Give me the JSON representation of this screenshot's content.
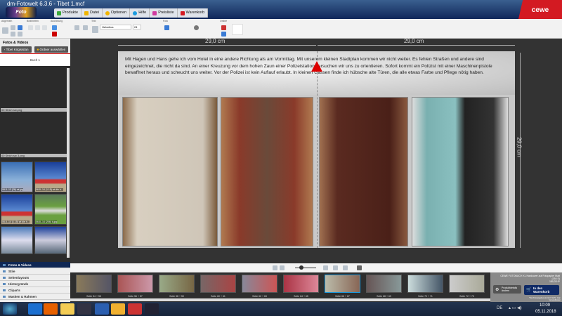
{
  "window": {
    "title": "dm-Fotowelt 6.3.6 - Tibet 1.mcf",
    "logo": "Foto Paradies",
    "brand": "cewe"
  },
  "menu": [
    {
      "label": "Produkte",
      "color": "#3aa83a"
    },
    {
      "label": "Datei",
      "color": "#f0b400"
    },
    {
      "label": "Optionen",
      "color": "#f0b400"
    },
    {
      "label": "Hilfe",
      "color": "#1a9be0"
    },
    {
      "label": "Preisliste",
      "color": "#d03aa0"
    },
    {
      "label": "Warenkorb",
      "color": "#d31a22"
    }
  ],
  "toolbar": {
    "groups": [
      "Allgemein",
      "Bearbeiten",
      "Anordnung",
      "Text",
      "Foto",
      "Online"
    ],
    "font": "Helvetica",
    "font_size": "24"
  },
  "left_panel": {
    "title": "Fotos & Videos",
    "back_button": "Tibet Kirgisistan",
    "folder_button": "Ordner auswählen",
    "book": "Buch 1",
    "files": [
      "00 Strich sw.png",
      "00 Strich sw 3.png"
    ],
    "photos": [
      "06.8.-13 (26) wi.jpg",
      "06.8.-14 (1.15) wi die h...",
      "06.8.-14 (1.15) wi die h...",
      "06.8.-14 (206) k.jpg",
      "",
      ""
    ],
    "nav": [
      "Fotos & Videos",
      "Stile",
      "Seitenlayouts",
      "Hintergründe",
      "Cliparts",
      "Masken & Rahmen"
    ]
  },
  "canvas": {
    "ruler_top": "29,0 cm",
    "ruler_right": "29,0 cm",
    "text": "Mit Hagen und Hans gehe ich vom Hotel in eine andere Richtung als am Vormittag. Mit unserem kleinen Stadtplan kommen wir nicht weiter. Es fehlen Straßen und andere sind eingezeichnet, die nicht da sind. An einer Kreuzung vor dem hohen Zaun einer Polizeistation versuchen wir uns zu orientieren. Sofort kommt ein Polizist mit einer Maschinenpistole bewaffnet heraus und scheucht uns weiter. Vor der Polizei ist kein Auflauf erlaubt. In kleinen Gassen finde ich hübsche alte Türen, die alle etwas Farbe und Pflege nötig haben."
  },
  "filmstrip": [
    "Seite 54 + 55",
    "Seite 56 + 57",
    "Seite 58 + 59",
    "Seite 60 + 61",
    "Seite 62 + 63",
    "Seite 64 + 65",
    "Seite 66 + 67",
    "Seite 68 + 69",
    "Seite 70 + 71",
    "Seite 72 + 73"
  ],
  "info": {
    "product": "CEWE FOTOBUCH XL Hardcover auf Fotopapier Matt",
    "pages": "(154 S)",
    "price": "180,33 €*",
    "details_button": "Produktdetails ändern",
    "cart_button": "In den Warenkorb",
    "note": "*Die Preisangaben sind incl. MwSt. zzgl. Versandkosten"
  },
  "taskbar": {
    "lang": "DE",
    "time": "10:09",
    "date": "05.11.2018"
  }
}
